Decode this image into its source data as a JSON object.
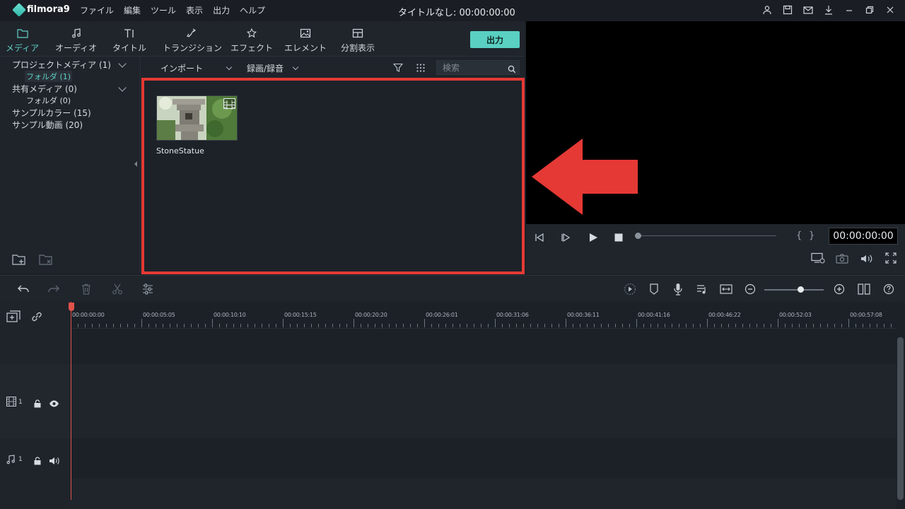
{
  "app": {
    "name": "filmora9",
    "document_title": "タイトルなし: 00:00:00:00",
    "menu": [
      "ファイル",
      "編集",
      "ツール",
      "表示",
      "出力",
      "ヘルプ"
    ]
  },
  "tabs": [
    {
      "label": "メディア",
      "icon": "folder-icon",
      "active": true
    },
    {
      "label": "オーディオ",
      "icon": "music-note-icon"
    },
    {
      "label": "タイトル",
      "icon": "title-icon"
    },
    {
      "label": "トランジション",
      "icon": "transition-icon"
    },
    {
      "label": "エフェクト",
      "icon": "effect-icon"
    },
    {
      "label": "エレメント",
      "icon": "element-icon"
    },
    {
      "label": "分割表示",
      "icon": "split-screen-icon"
    }
  ],
  "export_label": "出力",
  "sidebar": {
    "items": [
      {
        "label": "プロジェクトメディア (1)"
      },
      {
        "label": "フォルダ (1)"
      },
      {
        "label": "共有メディア (0)"
      },
      {
        "label": "フォルダ (0)"
      },
      {
        "label": "サンプルカラー (15)"
      },
      {
        "label": "サンプル動画 (20)"
      }
    ]
  },
  "media_toolbar": {
    "import_label": "インポート",
    "record_label": "録画/録音",
    "search_placeholder": "検索"
  },
  "media": [
    {
      "name": "StoneStatue"
    }
  ],
  "preview": {
    "timecode": "00:00:00:00"
  },
  "timeline": {
    "ruler": [
      "00:00:00:00",
      "00:00:05:05",
      "00:00:10:10",
      "00:00:15:15",
      "00:00:20:20",
      "00:00:26:01",
      "00:00:31:06",
      "00:00:36:11",
      "00:00:41:16",
      "00:00:46:22",
      "00:00:52:03",
      "00:00:57:08"
    ],
    "video_track": "1",
    "audio_track": "1"
  },
  "colors": {
    "accent": "#5fd1c5",
    "highlight_box": "#e53935",
    "arrow": "#e53935"
  }
}
